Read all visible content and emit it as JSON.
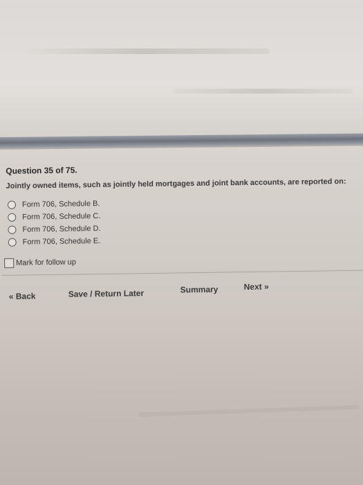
{
  "question": {
    "title": "Question 35 of 75.",
    "text": "Jointly owned items, such as jointly held mortgages and joint bank accounts, are reported on:",
    "options": [
      {
        "label": "Form 706, Schedule B."
      },
      {
        "label": "Form 706, Schedule C."
      },
      {
        "label": "Form 706, Schedule D."
      },
      {
        "label": "Form 706, Schedule E."
      }
    ]
  },
  "mark_for_follow_up": {
    "label": "Mark for follow up",
    "checked": false
  },
  "nav": {
    "back_label": "« Back",
    "save_label": "Save / Return Later",
    "summary_label": "Summary",
    "next_label": "Next »"
  }
}
